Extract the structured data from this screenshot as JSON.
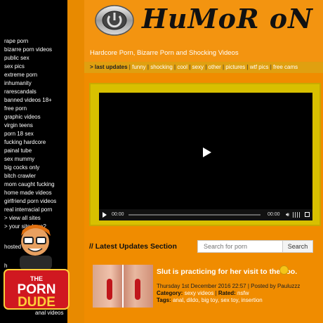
{
  "sidebar": {
    "links": [
      "rape porn",
      "bizarre porn videos",
      "public sex",
      "sex pics",
      "extreme porn",
      "inhumanity",
      "rarescandals",
      "banned videos 18+",
      "free porn",
      "graphic videos",
      "virgin teens",
      "porn 18 sex",
      "fucking hardcore",
      "painal tube",
      "sex mummy",
      "big cocks only",
      "bitch crawler",
      "mom caught fucking",
      "home made videos",
      "girlfriend porn videos",
      "real interracial porn",
      "> view all sites",
      "> your site here?"
    ],
    "hosted_label": "hosted",
    "misc_label": "h",
    "bottom_label": "anal videos",
    "badge": {
      "line1": "THE",
      "line2": "PORN",
      "line3": "DUDE"
    }
  },
  "header": {
    "logo_text": "HuMoR oN",
    "tagline": "Hardcore Porn, Bizarre Porn and Shocking Videos"
  },
  "nav": {
    "items": [
      "> last updates",
      "funny",
      "shocking",
      "cool",
      "sexy",
      "other",
      "pictures",
      "wtf pics",
      "free cams"
    ]
  },
  "player": {
    "current_time": "00:00",
    "duration": "00:00"
  },
  "latest": {
    "section_title": "// Latest Updates Section",
    "search_placeholder": "Search for porn",
    "search_button": "Search"
  },
  "post": {
    "title": "Slut is practicing for her visit to the zoo.",
    "date_line": "Thursday 1st December 2016 22:57 | Posted by Pauluzzz",
    "category_label": "Category:",
    "category_value": "sexy videos",
    "rated_label": "Rated:",
    "rated_value": "nsfw",
    "tags_label": "Tags:",
    "tags_value": "anal, dildo, big toy, sex toy, insertion"
  },
  "colors": {
    "main_bg": "#f08c00",
    "nav_bg": "#e0a010",
    "video_frame": "#d8c000",
    "sidebar_bg": "#000000"
  }
}
